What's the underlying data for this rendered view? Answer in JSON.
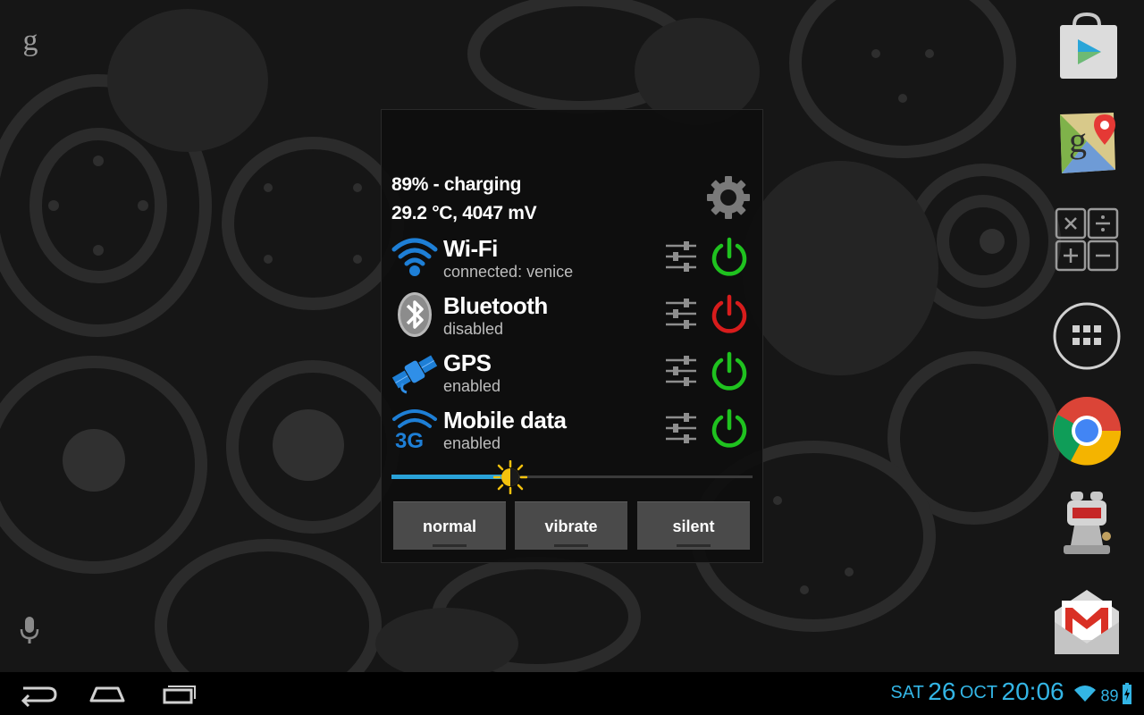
{
  "home": {
    "search_glyph": "g"
  },
  "widget": {
    "battery_status": "89% - charging",
    "battery_details": "29.2 °C, 4047 mV",
    "toggles": [
      {
        "icon": "wifi-icon",
        "name": "Wi-Fi",
        "status": "connected: venice",
        "power": "on"
      },
      {
        "icon": "bluetooth-icon",
        "name": "Bluetooth",
        "status": "disabled",
        "power": "off"
      },
      {
        "icon": "gps-satellite-icon",
        "name": "GPS",
        "status": "enabled",
        "power": "on"
      },
      {
        "icon": "mobile-data-3g-icon",
        "name": "Mobile data",
        "status": "enabled",
        "power": "on"
      }
    ],
    "brightness_level": 0.33,
    "sound_modes": [
      "normal",
      "vibrate",
      "silent"
    ]
  },
  "dock": [
    "play-store-icon",
    "maps-icon",
    "calculator-icon",
    "app-drawer-icon",
    "chrome-icon",
    "robot-app-icon",
    "gmail-icon"
  ],
  "statusbar": {
    "day": "SAT",
    "date": "26",
    "month": "OCT",
    "time": "20:06",
    "battery_level": "89"
  },
  "colors": {
    "accent": "#33b5e5",
    "power_on": "#1fc21f",
    "power_off": "#d81c1c"
  }
}
